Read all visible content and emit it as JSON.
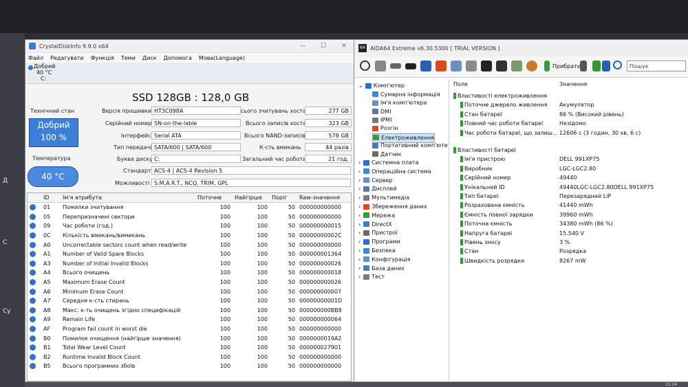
{
  "desktop": {
    "side_labels": [
      "Д",
      "С",
      "Су"
    ],
    "clock": "21:24"
  },
  "cdi": {
    "title": "CrystalDiskInfo 9.9.0 x64",
    "window_buttons": [
      "—",
      "☐",
      "✕"
    ],
    "menu": [
      "Файл",
      "Редагувати",
      "Функція",
      "Теми",
      "Диск",
      "Допомога",
      "Мова(Language)"
    ],
    "disk_status": "Добрий",
    "disk_temp": "40 °C",
    "disk_letter": "C:",
    "model": "SSD 128GB : 128,0 GB",
    "health_label": "Технічний стан",
    "health_text": "Добрий",
    "health_pct": "100 %",
    "temp_label": "Температура",
    "temp_value": "40 °C",
    "fields": {
      "firmware_label": "Версія прошивки",
      "firmware": "HT3C098A",
      "serial_label": "Серійний номер",
      "serial": "SN-on-the-lable",
      "interface_label": "Інтерфейс",
      "interface": "Serial ATA",
      "transfer_label": "Тип передачі",
      "transfer": "SATA/600 | SATA/600",
      "drive_letter_label": "Буква диску",
      "drive_letter": "C:",
      "standard_label": "Стандарт",
      "standard": "ACS-4 | ACS-4 Revision 5",
      "features_label": "Можливості",
      "features": "S.M.A.R.T., NCQ, TRIM, GPL",
      "host_reads_label": "сього зчитувань хоста",
      "host_reads": "277 GB",
      "host_writes_label": "Всього записів хоста",
      "host_writes": "323 GB",
      "nand_writes_label": "Всього NAND-записів",
      "nand_writes": "578 GB",
      "power_count_label": "К-сть вмикань",
      "power_count": "44 разів",
      "power_hours_label": "Загальний час роботи",
      "power_hours": "21 год."
    },
    "smart_headers": [
      "ID",
      "Ім'я атрибута",
      "Поточне",
      "Найгірше",
      "Поріг",
      "Raw-значення"
    ],
    "smart_rows": [
      [
        "01",
        "Помилки зчитування",
        "100",
        "100",
        "50",
        "000000000000"
      ],
      [
        "05",
        "Перепризначені сектори",
        "100",
        "100",
        "50",
        "000000000000"
      ],
      [
        "09",
        "Час роботи (год.)",
        "100",
        "100",
        "50",
        "000000000015"
      ],
      [
        "0C",
        "Кількість вмикань/вимикань",
        "100",
        "100",
        "50",
        "00000000002C"
      ],
      [
        "A0",
        "Uncorrectable sectors count when read/write",
        "100",
        "100",
        "50",
        "000000000000"
      ],
      [
        "A1",
        "Number of Valid Spare Blocks",
        "100",
        "100",
        "50",
        "000000001364"
      ],
      [
        "A3",
        "Number of Initial Invalid Blocks",
        "100",
        "100",
        "50",
        "000000000026"
      ],
      [
        "A4",
        "Всього очищень",
        "100",
        "100",
        "50",
        "000000000018"
      ],
      [
        "A5",
        "Maximum Erase Count",
        "100",
        "100",
        "50",
        "000000000026"
      ],
      [
        "A6",
        "Minimum Erase Count",
        "100",
        "100",
        "50",
        "000000000007"
      ],
      [
        "A7",
        "Середня к-сть стирань",
        "100",
        "100",
        "50",
        "00000000001D"
      ],
      [
        "A8",
        "Макс. к-ть очищень згідно специфікацій",
        "100",
        "100",
        "50",
        "000000000BB8"
      ],
      [
        "A9",
        "Remain Life",
        "100",
        "100",
        "50",
        "000000000064"
      ],
      [
        "AF",
        "Program fail count in worst die",
        "100",
        "100",
        "50",
        "000000000000"
      ],
      [
        "B0",
        "Помилок очищення (найгірше значення)",
        "100",
        "100",
        "50",
        "0000000019A2"
      ],
      [
        "B1",
        "Total Wear Level Count",
        "100",
        "100",
        "50",
        "000000027901"
      ],
      [
        "B2",
        "Runtime Invalid Block Count",
        "100",
        "100",
        "50",
        "000000000000"
      ],
      [
        "B5",
        "Всього програмних збоїв",
        "100",
        "100",
        "50",
        "000000000000"
      ]
    ]
  },
  "aida": {
    "title": "AIDA64 Extreme v6.30.5300  [ TRIAL VERSION ]",
    "icon_text": "64",
    "toolbar_report": "Прибрати",
    "search_placeholder": "Пошук",
    "tree": [
      {
        "label": "Комп'ютер",
        "level": 0
      },
      {
        "label": "Сумарна інформація",
        "level": 1
      },
      {
        "label": "Ім'я комп'ютера",
        "level": 1
      },
      {
        "label": "DMI",
        "level": 1
      },
      {
        "label": "IPMI",
        "level": 1
      },
      {
        "label": "Розгін",
        "level": 1
      },
      {
        "label": "Електроживлення",
        "level": 1,
        "selected": true
      },
      {
        "label": "Портативний комп'юте",
        "level": 1
      },
      {
        "label": "Датчик",
        "level": 1
      },
      {
        "label": "Системна плата",
        "level": 0
      },
      {
        "label": "Операційна система",
        "level": 0
      },
      {
        "label": "Сервер",
        "level": 0
      },
      {
        "label": "Дисплей",
        "level": 0
      },
      {
        "label": "Мультимедіа",
        "level": 0
      },
      {
        "label": "Збереження даних",
        "level": 0
      },
      {
        "label": "Мережа",
        "level": 0
      },
      {
        "label": "DirectX",
        "level": 0
      },
      {
        "label": "Пристрої",
        "level": 0
      },
      {
        "label": "Програми",
        "level": 0
      },
      {
        "label": "Безпека",
        "level": 0
      },
      {
        "label": "Конфігурація",
        "level": 0
      },
      {
        "label": "База даних",
        "level": 0
      },
      {
        "label": "Тест",
        "level": 0
      }
    ],
    "col_field": "Поле",
    "col_value": "Значення",
    "rows": [
      {
        "field": "Властивості електроживлення",
        "value": "",
        "group": true
      },
      {
        "field": "Поточне джерело живлення",
        "value": "Акумулятор"
      },
      {
        "field": "Стан батареї",
        "value": "86 % (Високий рівень)"
      },
      {
        "field": "Повний час роботи батареї",
        "value": "Незідомо"
      },
      {
        "field": "Час роботи батареї, що залиш...",
        "value": "12606 с (3 годин, 30 хв, 6 с)"
      },
      {
        "field": "",
        "value": "",
        "spacer": true
      },
      {
        "field": "Властивості батареї",
        "value": "",
        "group": true
      },
      {
        "field": "Ім'я пристрою",
        "value": "DELL 991XP75"
      },
      {
        "field": "Виробник",
        "value": "LGC-LGC2.80"
      },
      {
        "field": "Серійний номер",
        "value": "49440"
      },
      {
        "field": "Унікальний ID",
        "value": "49440LGC-LGC2.80DELL 991XP75"
      },
      {
        "field": "Тип батареї",
        "value": "Перезарядний LiP"
      },
      {
        "field": "Розрахована ємність",
        "value": "41440 mWh"
      },
      {
        "field": "Ємність повної зарядки",
        "value": "39960 mWh"
      },
      {
        "field": "Поточна ємність",
        "value": "34380 mWh  (86 %)"
      },
      {
        "field": "Напруга батареї",
        "value": "15.540 V"
      },
      {
        "field": "Рівень зносу",
        "value": "3 %"
      },
      {
        "field": "Стан",
        "value": "Розрядка"
      },
      {
        "field": "Швидкість розрядки",
        "value": "8267 mW"
      }
    ]
  }
}
